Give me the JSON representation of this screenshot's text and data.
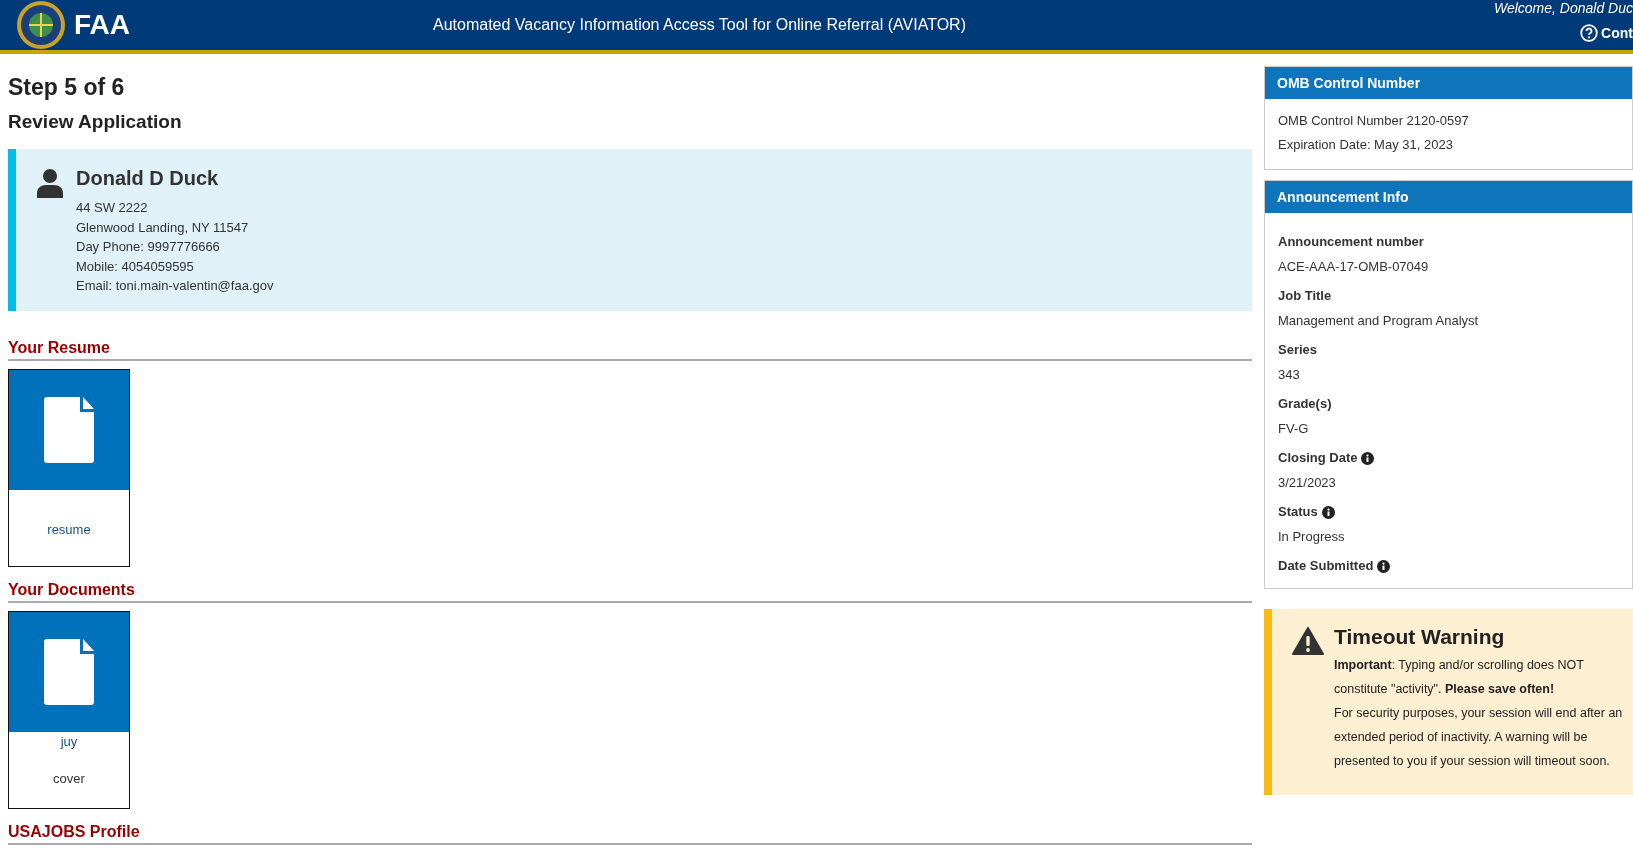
{
  "header": {
    "agency": "FAA",
    "title": "Automated Vacancy Information Access Tool for Online Referral (AVIATOR)",
    "welcome": "Welcome, Donald Duc",
    "contact_link": "Cont"
  },
  "step": "Step 5 of 6",
  "subtitle": "Review Application",
  "applicant": {
    "name": "Donald D Duck",
    "lines": [
      "44 SW 2222",
      "Glenwood Landing, NY 11547",
      "Day Phone: 9997776666",
      "Mobile: 4054059595",
      "Email: toni.main-valentin@faa.gov"
    ]
  },
  "sections": [
    {
      "title": "Your Resume",
      "files": [
        {
          "labels": [
            {
              "text": "resume",
              "kind": "link"
            }
          ]
        }
      ]
    },
    {
      "title": "Your Documents",
      "files": [
        {
          "labels": [
            {
              "text": "juy",
              "kind": "link"
            },
            {
              "text": "cover",
              "kind": "plain"
            }
          ]
        }
      ]
    },
    {
      "title": "USAJOBS Profile"
    }
  ],
  "omb": {
    "title": "OMB Control Number",
    "lines": [
      "OMB Control Number 2120-0597",
      "Expiration Date: May 31, 2023"
    ]
  },
  "announcement": {
    "title": "Announcement Info",
    "fields": [
      {
        "label": "Announcement number",
        "value": "ACE-AAA-17-OMB-07049",
        "info": false
      },
      {
        "label": "Job Title",
        "value": "Management and Program Analyst",
        "info": false
      },
      {
        "label": "Series",
        "value": "343",
        "info": false
      },
      {
        "label": "Grade(s)",
        "value": "FV-G",
        "info": false
      },
      {
        "label": "Closing Date",
        "value": "3/21/2023",
        "info": true
      },
      {
        "label": "Status",
        "value": "In Progress",
        "info": true
      },
      {
        "label": "Date Submitted",
        "info": true
      }
    ]
  },
  "timeout": {
    "title": "Timeout Warning",
    "paragraphs": [
      "**Important**: Typing and/or scrolling does NOT constitute \"activity\". **Please save often!**",
      "For security purposes, your session will end after an extended period of inactivity. A warning will be presented to you if your session will timeout soon."
    ]
  }
}
